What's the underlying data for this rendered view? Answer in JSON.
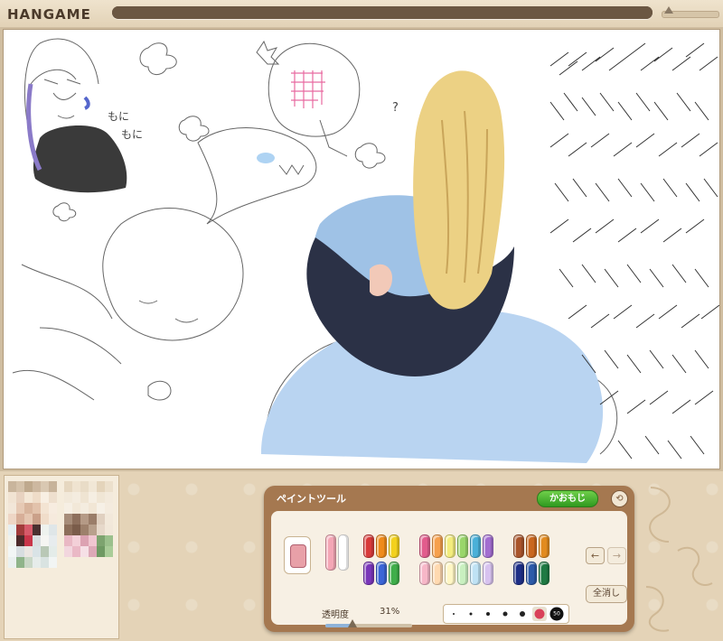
{
  "app": {
    "logo": "HANGAME",
    "progress": 1.0,
    "colors": {
      "progress_track": "#7a6650",
      "frame": "#e4d3b7"
    }
  },
  "paint_tool": {
    "title": "ペイントツール",
    "kaomoji_label": "かおもじ",
    "close_icon": "close-icon",
    "clear_label": "全消し",
    "opacity": {
      "label": "透明度",
      "value": "31%",
      "level": 0.31
    },
    "brush_size_selected": "50",
    "arrows": {
      "back": "←",
      "forward": "→"
    },
    "palette": [
      [
        "#f4a7b6",
        "#ffffff",
        "#d83a3a",
        "#ef8a1b",
        "#f3d11d",
        "#e25c8d",
        "#f6a04d",
        "#f3ec7d",
        "#9ad66b",
        "#4ab0d8",
        "#a26dd0",
        "#a9542b",
        "#c9671f",
        "#e28b1f"
      ],
      [
        "#222222",
        "#ffffff",
        "#7a36b9",
        "#3b65d6",
        "#3fae4a",
        "#f7b7c8",
        "#ffd9b0",
        "#fff6c4",
        "#c9f0c0",
        "#bfe2f4",
        "#d7c2ef",
        "#1e2f86",
        "#2c5aa8",
        "#1f7a43"
      ]
    ]
  }
}
